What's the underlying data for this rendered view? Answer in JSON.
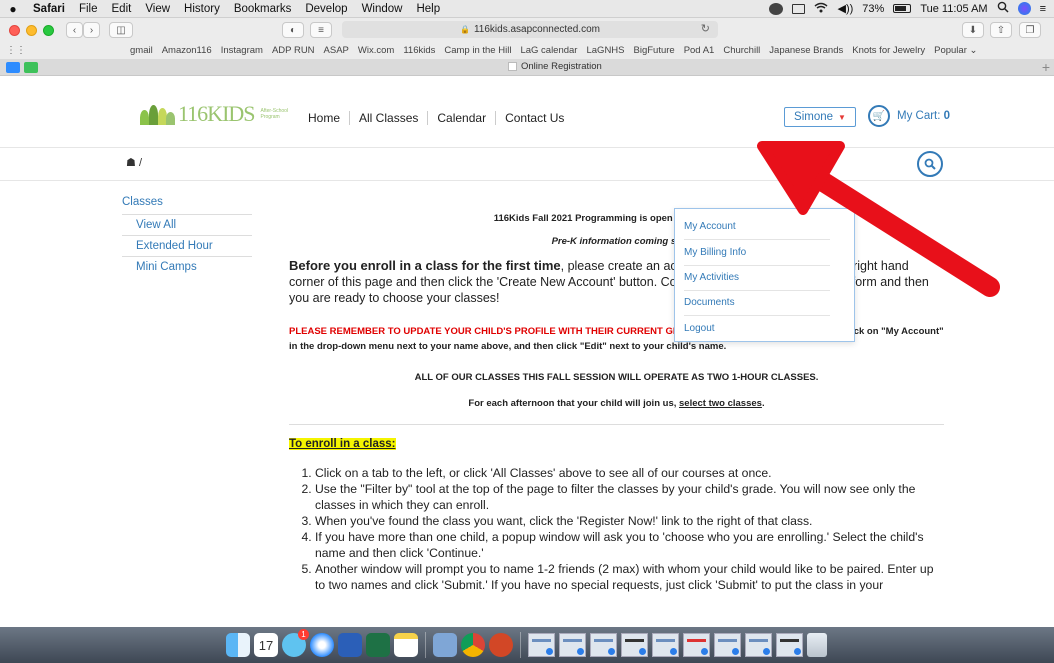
{
  "menubar": {
    "app": "Safari",
    "items": [
      "File",
      "Edit",
      "View",
      "History",
      "Bookmarks",
      "Develop",
      "Window",
      "Help"
    ],
    "battery": "73%",
    "clock": "Tue 11:05 AM"
  },
  "browser": {
    "url": "116kids.asapconnected.com",
    "favorites": [
      "gmail",
      "Amazon116",
      "Instagram",
      "ADP RUN",
      "ASAP",
      "Wix.com",
      "116kids",
      "Camp in the Hill",
      "LaG calendar",
      "LaGNHS",
      "BigFuture",
      "Pod A1",
      "Churchill",
      "Japanese Brands",
      "Knots for Jewelry",
      "Popular ⌄"
    ],
    "tab_title": "Online Registration"
  },
  "site": {
    "logo_text": "116KIDS",
    "logo_sub_1": "After-School",
    "logo_sub_2": "Program",
    "nav": [
      "Home",
      "All Classes",
      "Calendar",
      "Contact Us"
    ],
    "user_name": "Simone",
    "cart_label": "My Cart:",
    "cart_count": "0",
    "breadcrumb": "/"
  },
  "sidebar": {
    "title": "Classes",
    "items": [
      "View All",
      "Extended Hour",
      "Mini Camps"
    ]
  },
  "dropdown": {
    "items": [
      "My Account",
      "My Billing Info",
      "My Activities",
      "Documents",
      "Logout"
    ]
  },
  "content": {
    "announcement_1": "116Kids Fall 2021 Programming is open to all PS116 st",
    "announcement_2": "Pre-K information coming sc",
    "intro_bold": "Before you enroll in a class for the first time",
    "intro_rest": ", please create an account. Click 'Login' in the upper right hand corner of this page and then click the 'Create New Account' button. Complete our account registration form and then you are ready to choose your classes!",
    "warning_red": "PLEASE REMEMBER TO UPDATE YOUR CHILD'S PROFILE WITH THEIR CURRENT GRADE.",
    "warning_rest": " To edit this information, login, click on \"My Account\" in the drop-down menu next to your name above, and then click \"Edit\" next to your child's name.",
    "notice_1": "ALL OF OUR CLASSES THIS FALL SESSION WILL OPERATE AS TWO 1-HOUR CLASSES.",
    "notice_2_pre": "For each afternoon that your child will join us, ",
    "notice_2_link": "select two classes",
    "notice_2_post": ".",
    "enroll_heading": "To enroll in a class:",
    "steps": [
      "Click on a tab to the left, or click 'All Classes' above to see all of our courses at once.",
      "Use the \"Filter by\" tool at the top of the page to filter the classes by your child's grade. You will now see only the classes in which they can enroll.",
      "When you've found the class you want, click the 'Register Now!' link to the right of that class.",
      "If you have more than one child, a popup window will ask you to 'choose who you are enrolling.' Select the child's name and then click 'Continue.'",
      "Another window will prompt you to name 1-2 friends (2 max) with whom your child would like to be paired. Enter up to two names and click 'Submit.' If you have no special requests, just click 'Submit' to put the class in your"
    ]
  },
  "dock": {
    "calendar_day": "17",
    "badge": "1"
  },
  "colors": {
    "link": "#337ab7",
    "warning": "#e00000",
    "highlight": "#f5f500",
    "arrow": "#e8101a",
    "logo_green": "#9ac46f"
  },
  "icons": [
    "apple-icon",
    "wifi-icon",
    "battery-icon",
    "search-icon",
    "home-icon",
    "cart-icon",
    "caret-down-icon",
    "reload-icon",
    "share-icon",
    "lock-icon",
    "arrow-annotation"
  ]
}
